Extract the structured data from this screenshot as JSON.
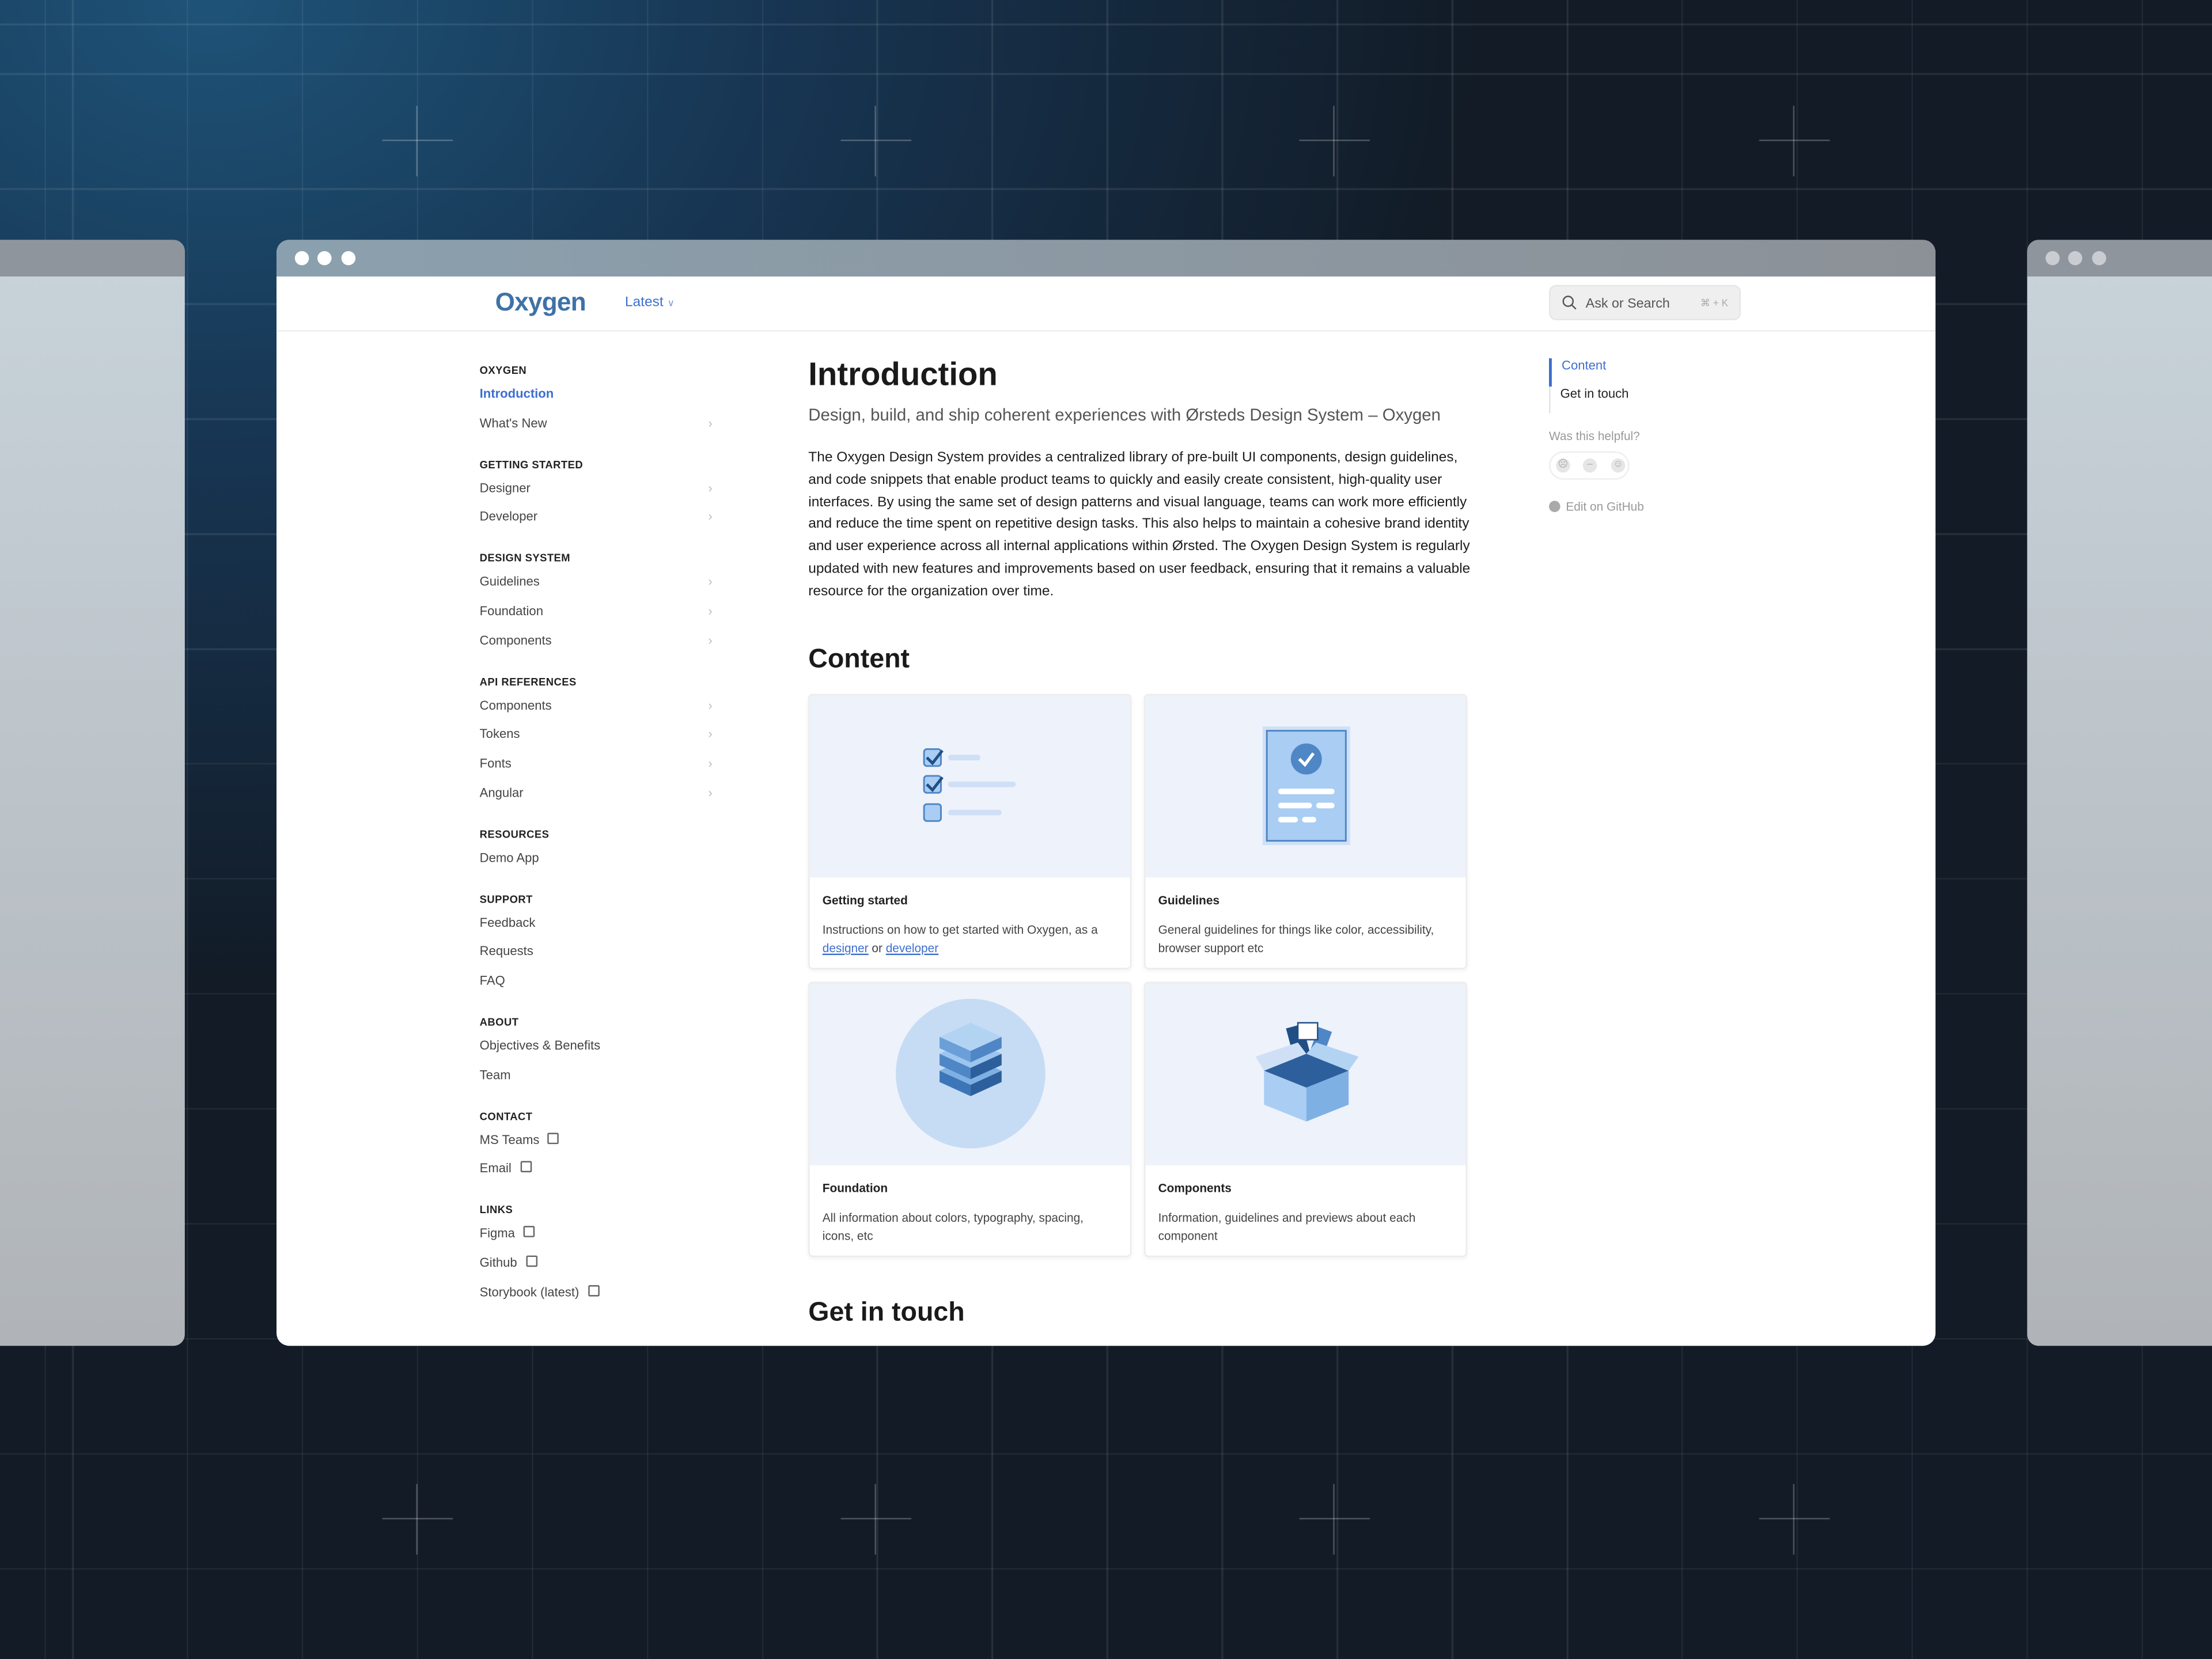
{
  "app": {
    "logo": "Oxygen",
    "version_selector": "Latest",
    "search": {
      "placeholder": "Ask or Search",
      "shortcut": "⌘ + K"
    }
  },
  "sidebar": {
    "sections": [
      {
        "title": "OXYGEN",
        "items": [
          {
            "label": "Introduction",
            "active": true
          },
          {
            "label": "What's New",
            "chevron": true
          }
        ]
      },
      {
        "title": "GETTING STARTED",
        "items": [
          {
            "label": "Designer",
            "chevron": true
          },
          {
            "label": "Developer",
            "chevron": true
          }
        ]
      },
      {
        "title": "DESIGN SYSTEM",
        "items": [
          {
            "label": "Guidelines",
            "chevron": true
          },
          {
            "label": "Foundation",
            "chevron": true
          },
          {
            "label": "Components",
            "chevron": true
          }
        ]
      },
      {
        "title": "API REFERENCES",
        "items": [
          {
            "label": "Components",
            "chevron": true
          },
          {
            "label": "Tokens",
            "chevron": true
          },
          {
            "label": "Fonts",
            "chevron": true
          },
          {
            "label": "Angular",
            "chevron": true
          }
        ]
      },
      {
        "title": "RESOURCES",
        "items": [
          {
            "label": "Demo App"
          }
        ]
      },
      {
        "title": "SUPPORT",
        "items": [
          {
            "label": "Feedback"
          },
          {
            "label": "Requests"
          },
          {
            "label": "FAQ"
          }
        ]
      },
      {
        "title": "ABOUT",
        "items": [
          {
            "label": "Objectives & Benefits"
          },
          {
            "label": "Team"
          }
        ]
      },
      {
        "title": "CONTACT",
        "items": [
          {
            "label": "MS Teams",
            "external": true
          },
          {
            "label": "Email",
            "external": true
          }
        ]
      },
      {
        "title": "LINKS",
        "items": [
          {
            "label": "Figma",
            "external": true
          },
          {
            "label": "Github",
            "external": true
          },
          {
            "label": "Storybook (latest)",
            "external": true
          }
        ]
      }
    ]
  },
  "main": {
    "title": "Introduction",
    "subtitle": "Design, build, and ship coherent experiences with Ørsteds Design System – Oxygen",
    "paragraph": "The Oxygen Design System provides a centralized library of pre-built UI components, design guidelines, and code snippets that enable product teams to quickly and easily create consistent, high-quality user interfaces. By using the same set of design patterns and visual language, teams can work more efficiently and reduce the time spent on repetitive design tasks. This also helps to maintain a cohesive brand identity and user experience across all internal applications within Ørsted. The Oxygen Design System is regularly updated with new features and improvements based on user feedback, ensuring that it remains a valuable resource for the organization over time.",
    "content_heading": "Content",
    "cards": [
      {
        "title": "Getting started",
        "desc_prefix": "Instructions on how to get started with Oxygen, as a ",
        "link1": "designer",
        "desc_mid": " or ",
        "link2": "developer",
        "icon": "checklist-illustration"
      },
      {
        "title": "Guidelines",
        "desc": "General guidelines for things like color, accessibility, browser support etc",
        "icon": "document-check-illustration"
      },
      {
        "title": "Foundation",
        "desc": "All information about colors, typography, spacing, icons, etc",
        "icon": "cube-stack-illustration"
      },
      {
        "title": "Components",
        "desc": "Information, guidelines and previews about each component",
        "icon": "open-box-illustration"
      }
    ],
    "contact_heading": "Get in touch"
  },
  "toc": {
    "items": [
      {
        "label": "Content",
        "active": true
      },
      {
        "label": "Get in touch"
      }
    ],
    "helpful": "Was this helpful?",
    "edit": "Edit on GitHub"
  },
  "colors": {
    "accent": "#3d6fcf",
    "logo": "#3e72a8",
    "card_bg": "#eef2fb"
  }
}
